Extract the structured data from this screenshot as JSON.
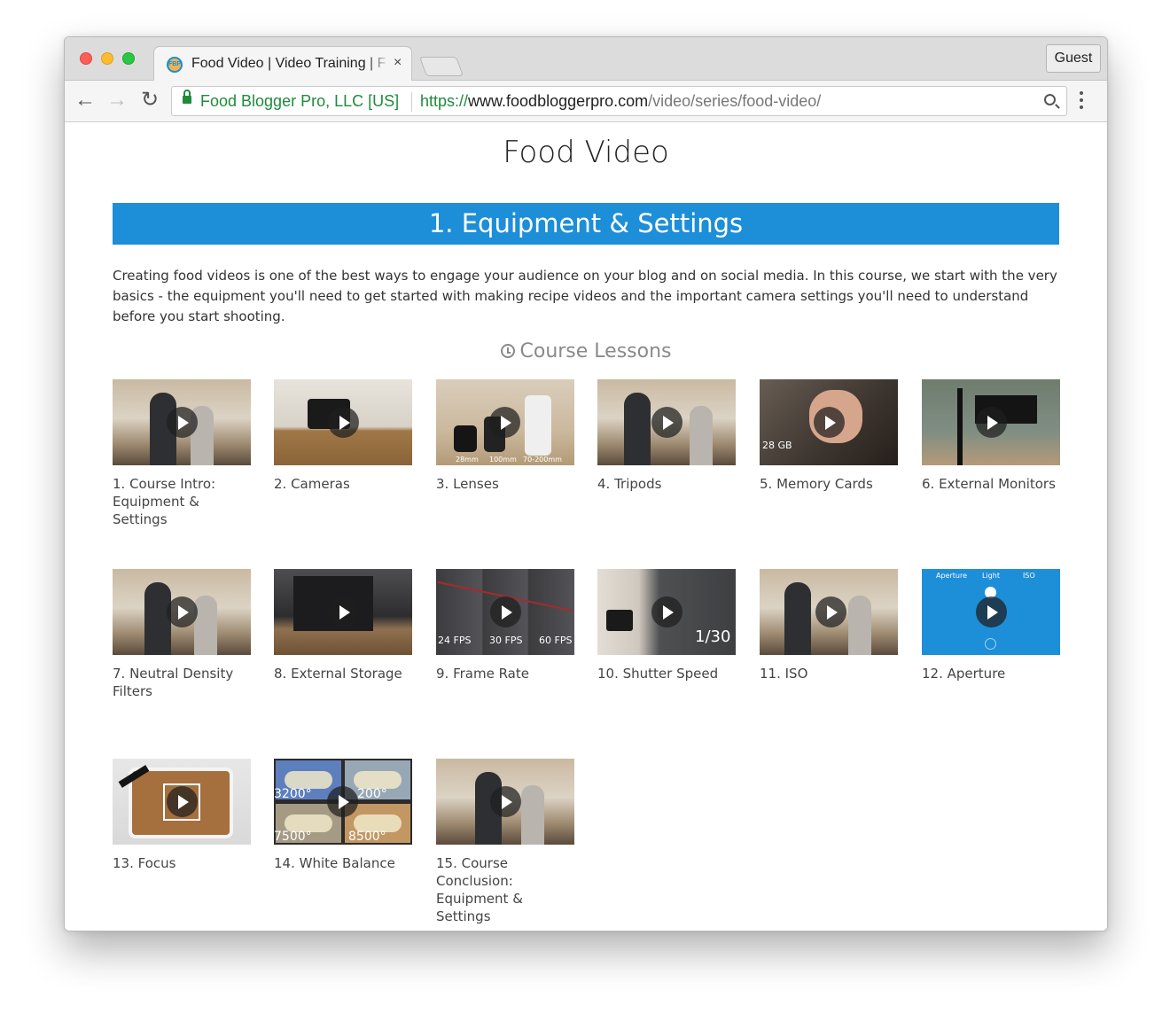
{
  "browser": {
    "tab_title": "Food Video | Video Training | F",
    "tab_favicon_text": "FBP",
    "tab_close": "×",
    "guest_label": "Guest",
    "nav": {
      "back": "←",
      "forward": "→",
      "reload": "↻"
    },
    "omnibox": {
      "org": "Food Blogger Pro, LLC [US]",
      "url_scheme": "https://",
      "url_host": "www.foodbloggerpro.com",
      "url_path": "/video/series/food-video/"
    }
  },
  "page": {
    "title": "Food Video",
    "section_title": "1. Equipment & Settings",
    "section_description": "Creating food videos is one of the best ways to engage your audience on your blog and on social media. In this course, we start with the very basics - the equipment you'll need to get started with making recipe videos and the important camera settings you'll need to understand before you start shooting.",
    "lessons_heading": "Course Lessons"
  },
  "lessons": [
    {
      "label": "1. Course Intro: Equipment & Settings"
    },
    {
      "label": "2. Cameras"
    },
    {
      "label": "3. Lenses",
      "thumb_text": [
        "28mm",
        "100mm",
        "70-200mm"
      ]
    },
    {
      "label": "4. Tripods"
    },
    {
      "label": "5. Memory Cards",
      "thumb_text": [
        "28 GB"
      ]
    },
    {
      "label": "6. External Monitors"
    },
    {
      "label": "7. Neutral Density Filters"
    },
    {
      "label": "8. External Storage"
    },
    {
      "label": "9. Frame Rate",
      "thumb_text": [
        "24 FPS",
        "30 FPS",
        "60 FPS"
      ]
    },
    {
      "label": "10. Shutter Speed",
      "thumb_text": [
        "1/30"
      ]
    },
    {
      "label": "11. ISO"
    },
    {
      "label": "12. Aperture",
      "thumb_text": [
        "Aperture",
        "Light",
        "ISO"
      ]
    },
    {
      "label": "13. Focus"
    },
    {
      "label": "14. White Balance",
      "thumb_text": [
        "3200°",
        "200°",
        "7500°",
        "8500°"
      ]
    },
    {
      "label": "15. Course Conclusion: Equipment & Settings"
    }
  ],
  "colors": {
    "accent": "#1d8ed8",
    "secure_green": "#1f8b3b"
  },
  "icons": {
    "favicon": "food-blogger-pro-logo",
    "lessons_heading": "clock-icon",
    "play": "play-icon",
    "chat": "chat-icon"
  }
}
